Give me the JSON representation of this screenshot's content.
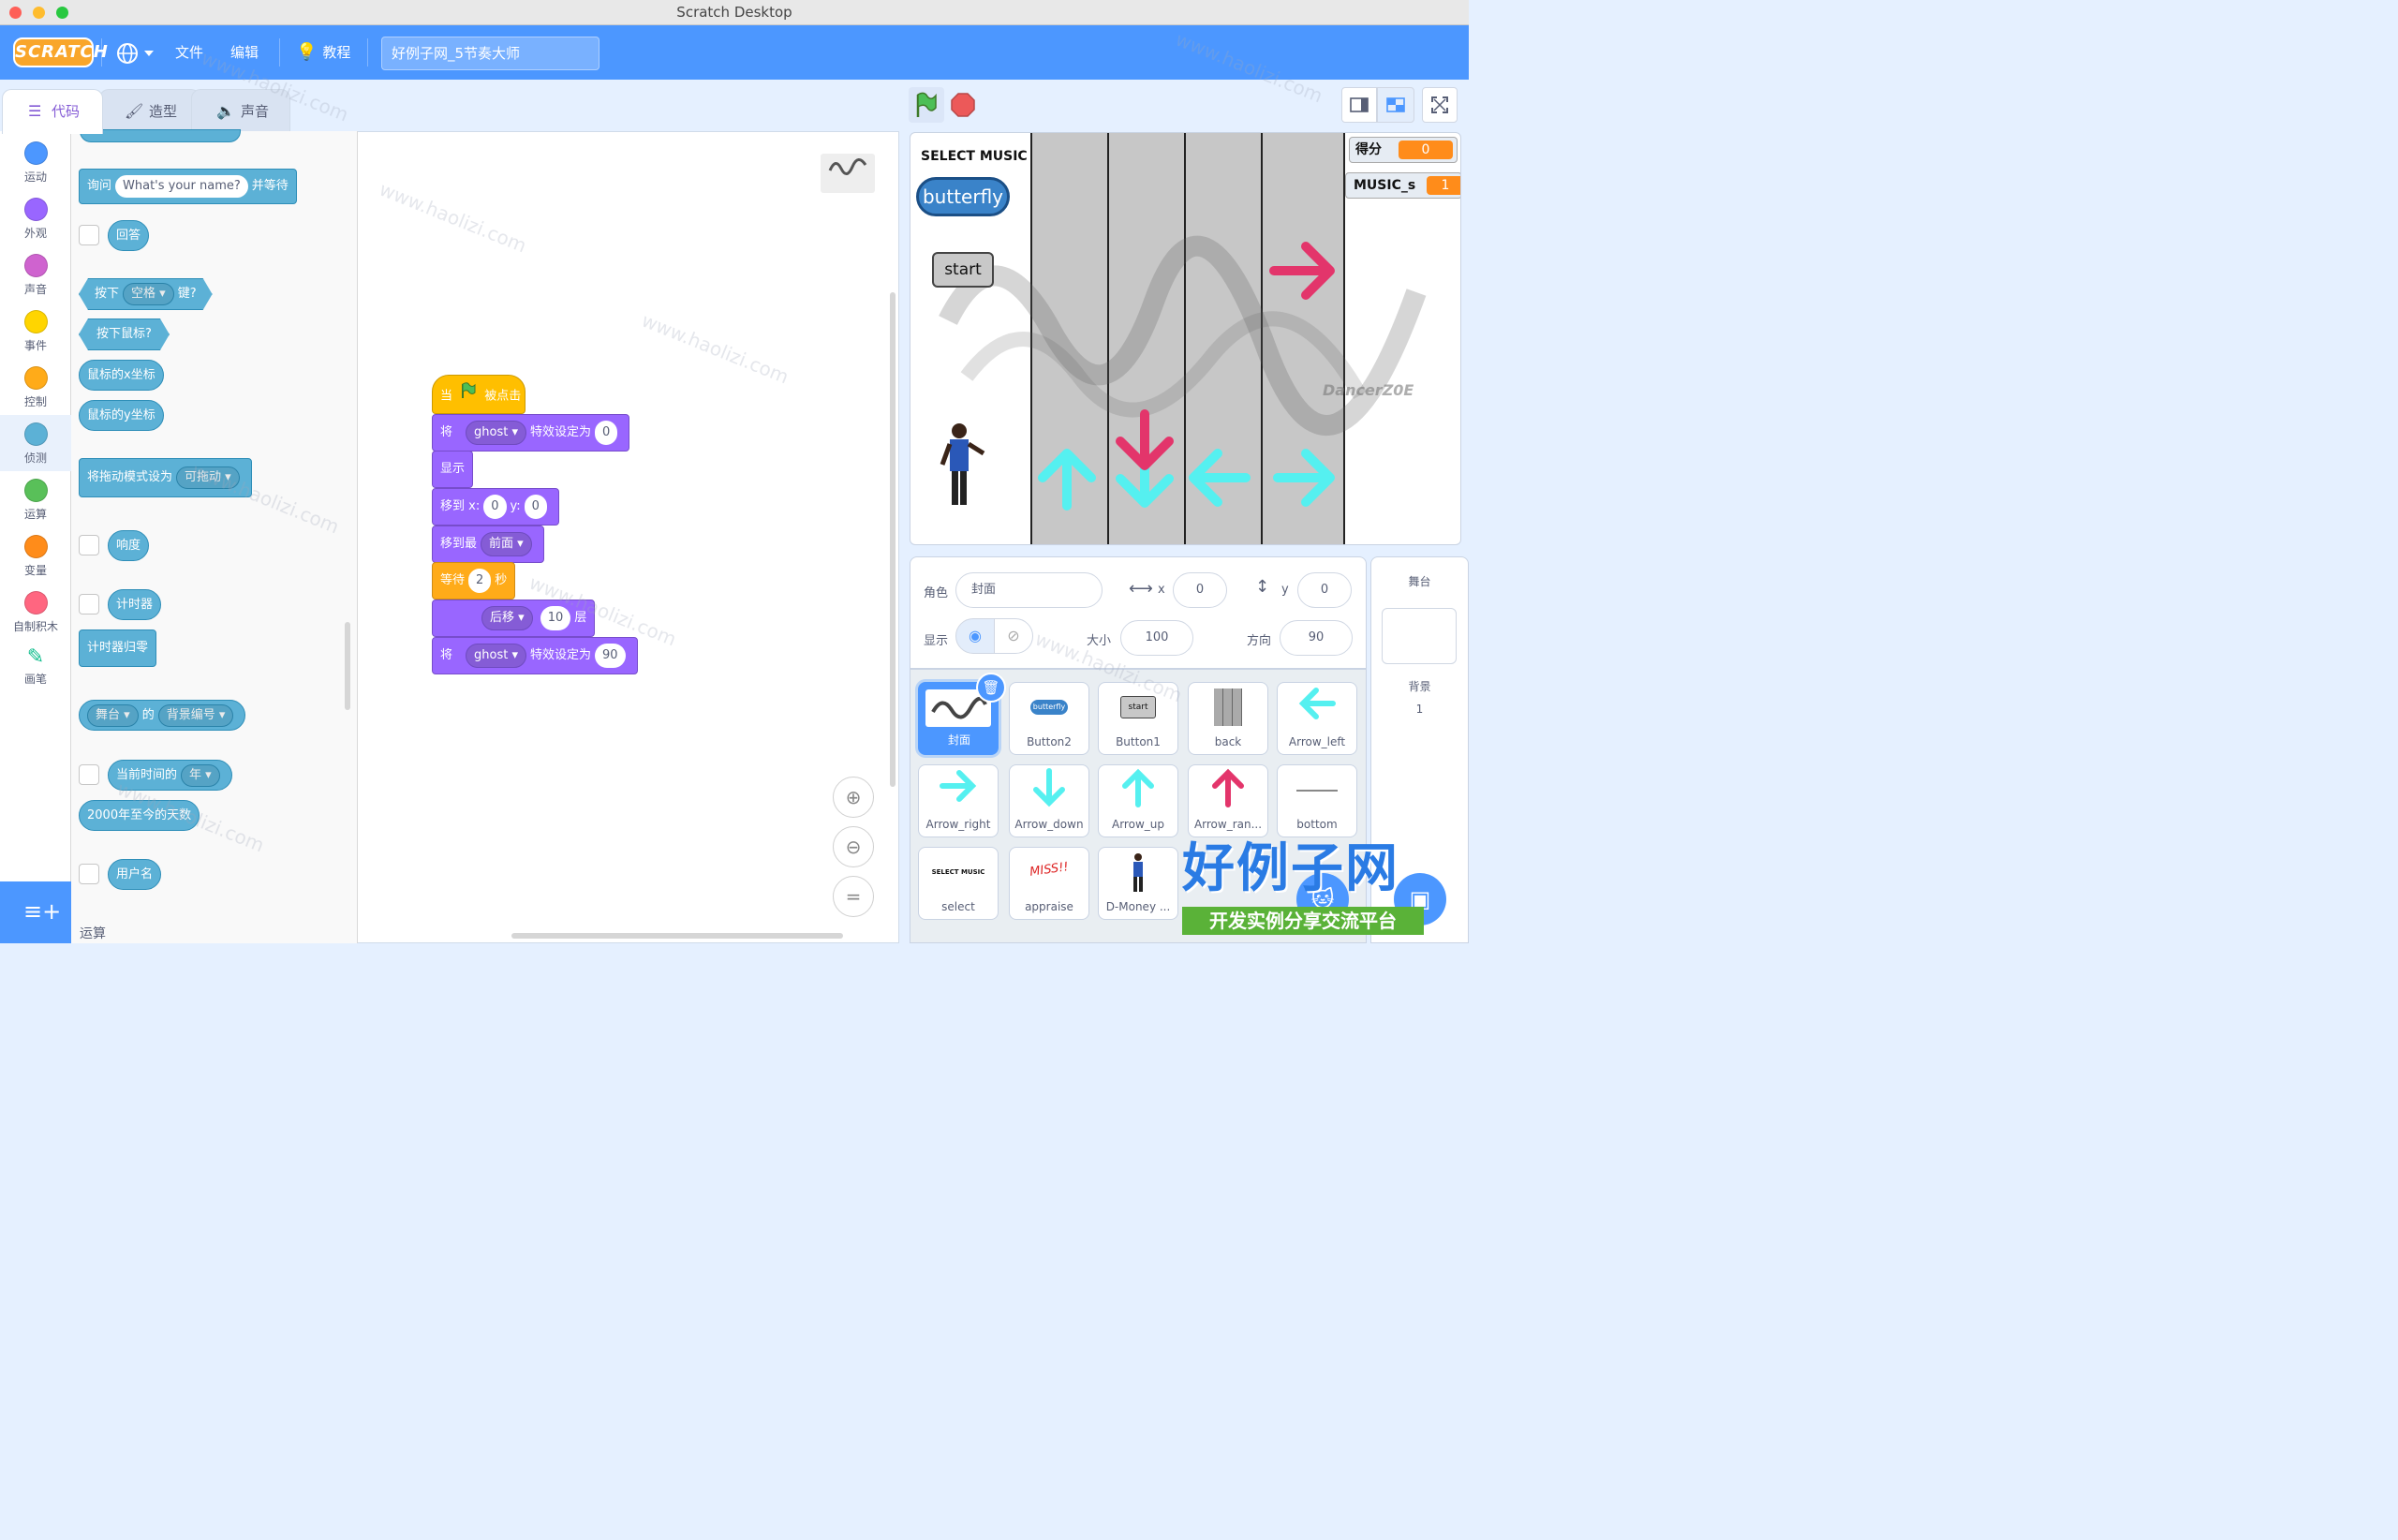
{
  "window": {
    "title": "Scratch Desktop"
  },
  "menubar": {
    "logo": "SCRATCH",
    "file": "文件",
    "edit": "编辑",
    "tutorials": "教程",
    "project_title": "好例子网_5节奏大师"
  },
  "tabs": {
    "code": "代码",
    "costumes": "造型",
    "sounds": "声音"
  },
  "categories": [
    {
      "label": "运动",
      "color": "#4c97ff"
    },
    {
      "label": "外观",
      "color": "#9966ff"
    },
    {
      "label": "声音",
      "color": "#cf63cf"
    },
    {
      "label": "事件",
      "color": "#ffd500"
    },
    {
      "label": "控制",
      "color": "#ffab19"
    },
    {
      "label": "侦测",
      "color": "#5cb1d6"
    },
    {
      "label": "运算",
      "color": "#59c059"
    },
    {
      "label": "变量",
      "color": "#ff8c1a"
    },
    {
      "label": "自制积木",
      "color": "#ff6680"
    },
    {
      "label": "画笔",
      "color": "#0fbd8c"
    }
  ],
  "palette": {
    "ask_prefix": "询问",
    "ask_default": "What's your name?",
    "ask_suffix": "并等待",
    "answer": "回答",
    "key_pressed_prefix": "按下",
    "key_pressed_key": "空格",
    "key_pressed_suffix": "键?",
    "mouse_down": "按下鼠标?",
    "mouse_x": "鼠标的x坐标",
    "mouse_y": "鼠标的y坐标",
    "drag_mode_prefix": "将拖动模式设为",
    "drag_mode_value": "可拖动",
    "loudness": "响度",
    "timer": "计时器",
    "reset_timer": "计时器归零",
    "of_target": "舞台",
    "of_word": "的",
    "of_attr": "背景编号",
    "current_prefix": "当前时间的",
    "current_value": "年",
    "days_since": "2000年至今的天数",
    "username": "用户名",
    "next_section": "运算"
  },
  "script": {
    "hat_prefix": "当",
    "hat_suffix": "被点击",
    "set_prefix": "将",
    "effect": "ghost",
    "set_mid": "特效设定为",
    "ghost_value_1": "0",
    "ghost_value_2": "90",
    "show": "显示",
    "goto_prefix": "移到 x:",
    "goto_x": "0",
    "goto_y_label": "y:",
    "goto_y": "0",
    "layer_prefix": "移到最",
    "layer_value": "前面",
    "wait_prefix": "等待",
    "wait_value": "2",
    "wait_suffix": "秒",
    "back_prefix": "后移",
    "back_value": "10",
    "back_suffix": "层"
  },
  "stage": {
    "select_music": "SELECT MUSIC",
    "butterfly": "butterfly",
    "start": "start",
    "score_label": "得分",
    "score_value": "0",
    "music_label": "MUSIC_s",
    "music_value": "1",
    "dancer_label": "DancerZ0E"
  },
  "sprite_info": {
    "sprite_label": "角色",
    "sprite_name": "封面",
    "x_label": "x",
    "x_value": "0",
    "y_label": "y",
    "y_value": "0",
    "show_label": "显示",
    "size_label": "大小",
    "size_value": "100",
    "direction_label": "方向",
    "direction_value": "90"
  },
  "sprites": [
    {
      "name": "封面"
    },
    {
      "name": "Button2"
    },
    {
      "name": "Button1"
    },
    {
      "name": "back"
    },
    {
      "name": "Arrow_left"
    },
    {
      "name": "Arrow_right"
    },
    {
      "name": "Arrow_down"
    },
    {
      "name": "Arrow_up"
    },
    {
      "name": "Arrow_ran..."
    },
    {
      "name": "bottom"
    },
    {
      "name": "select"
    },
    {
      "name": "appraise"
    },
    {
      "name": "D-Money ..."
    }
  ],
  "sprite_thumbs": {
    "butterfly": "butterfly",
    "start": "start",
    "select": "SELECT MUSIC",
    "appraise": "MISS!!"
  },
  "stage_panel": {
    "title": "舞台",
    "backdrops_label": "背景",
    "backdrops_count": "1"
  },
  "watermark": {
    "brand": "好例子网",
    "tagline": "开发实例分享交流平台",
    "url": "www.haolizi.com"
  }
}
